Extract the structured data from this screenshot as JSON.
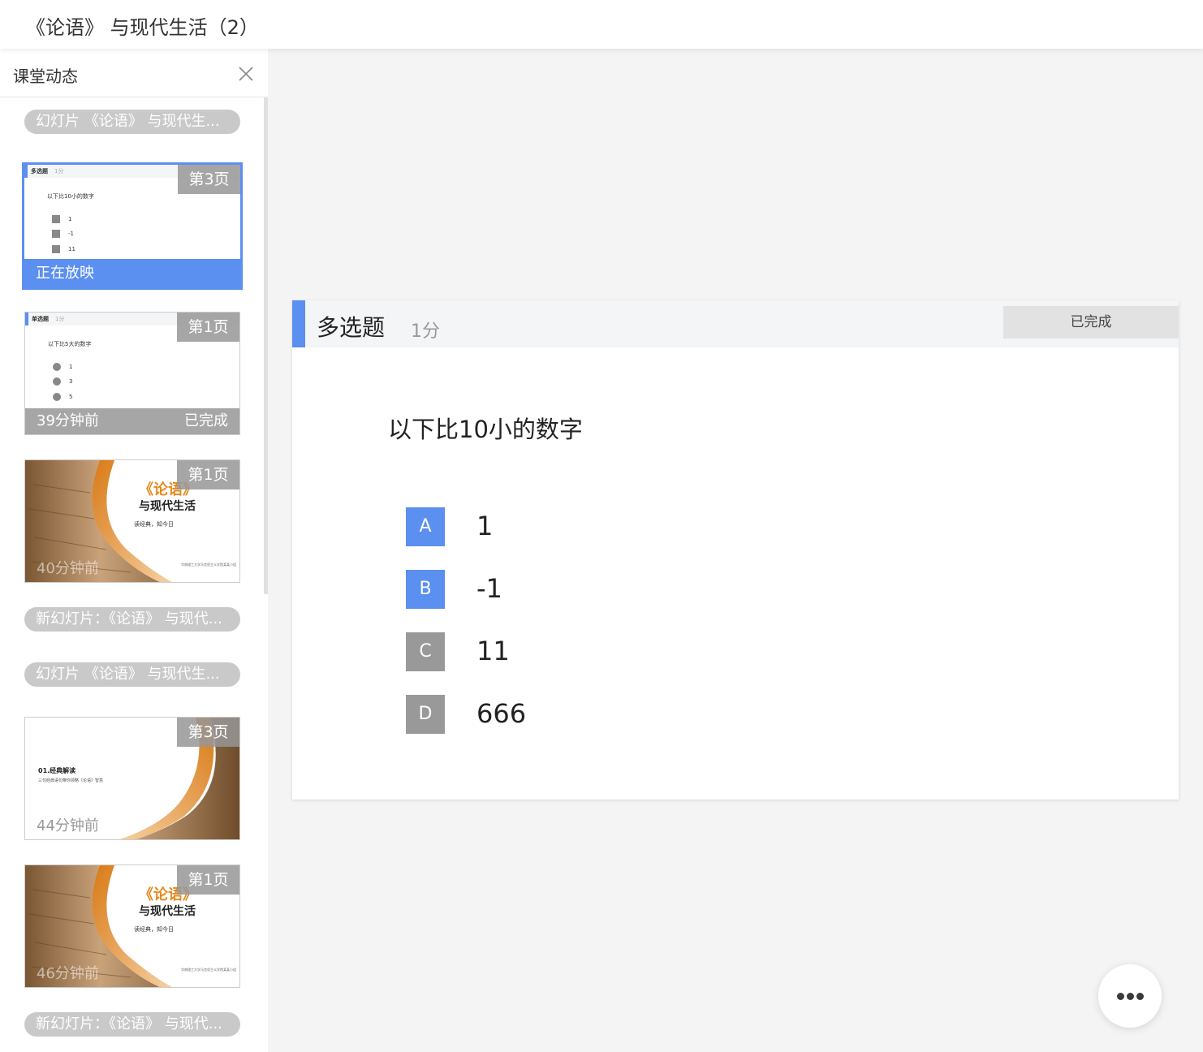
{
  "header": {
    "title": "《论语》 与现代生活（2）"
  },
  "sidebar": {
    "title": "课堂动态",
    "close_icon": "close-icon",
    "pills": [
      "幻灯片 《论语》 与现代生...",
      "新幻灯片：《论语》 与现代...",
      "幻灯片 《论语》 与现代生...",
      "新幻灯片：《论语》 与现代..."
    ],
    "cards": [
      {
        "page": "第3页",
        "footer": "正在放映",
        "thumb": {
          "type": "多选题",
          "score": "1分",
          "question": "以下比10小的数字",
          "options": [
            [
              "A",
              "1"
            ],
            [
              "B",
              "-1"
            ],
            [
              "C",
              "11"
            ]
          ]
        }
      },
      {
        "page": "第1页",
        "time": "39分钟前",
        "status": "已完成",
        "thumb": {
          "type": "单选题",
          "score": "1分",
          "question": "以下比5大的数字",
          "options": [
            [
              "A",
              "1"
            ],
            [
              "B",
              "3"
            ],
            [
              "C",
              "5"
            ]
          ]
        }
      },
      {
        "page": "第1页",
        "time": "40分钟前",
        "thumb": {
          "t1": "《论语》",
          "t2": "与现代生活",
          "t3": "读经典，知今日",
          "t4": "华南理工大学马克思主义学院某某小组"
        }
      },
      {
        "page": "第3页",
        "time": "44分钟前",
        "thumb": {
          "s1": "01.经典解读",
          "s2": "三句经典语句带你领略《论语》智慧"
        }
      },
      {
        "page": "第1页",
        "time": "46分钟前",
        "thumb": {
          "t1": "《论语》",
          "t2": "与现代生活",
          "t3": "读经典，知今日",
          "t4": "华南理工大学马克思主义学院某某小组"
        }
      }
    ]
  },
  "main": {
    "question_type": "多选题",
    "score": "1分",
    "status_button": "已完成",
    "question": "以下比10小的数字",
    "options": [
      {
        "letter": "A",
        "text": "1",
        "selected": true
      },
      {
        "letter": "B",
        "text": "-1",
        "selected": true
      },
      {
        "letter": "C",
        "text": "11",
        "selected": false
      },
      {
        "letter": "D",
        "text": "666",
        "selected": false
      }
    ]
  },
  "colors": {
    "accent": "#5b8ff0",
    "unselected": "#999999",
    "pill": "#c9c9c9",
    "scroll_orange": "#e58a1c"
  },
  "fab": {
    "icon": "more-dots-icon"
  }
}
